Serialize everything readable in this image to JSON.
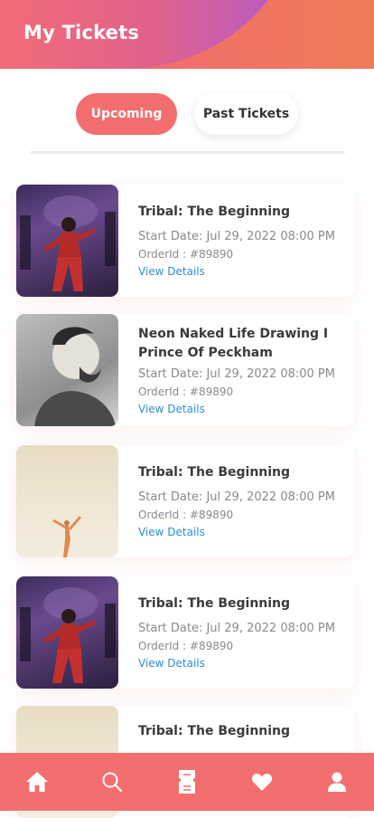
{
  "header": {
    "title": "My Tickets"
  },
  "tabs": [
    {
      "label": "Upcoming",
      "active": true
    },
    {
      "label": "Past Tickets",
      "active": false
    }
  ],
  "tickets": [
    {
      "title": "Tribal: The Beginning",
      "date": "Start Date: Jul 29, 2022 08:00 PM",
      "order": "OrderId : #89890",
      "link": "View Details"
    },
    {
      "title": "Neon Naked Life Drawing I Prince Of Peckham",
      "date": "Start Date: Jul 29, 2022 08:00 PM",
      "order": "OrderId : #89890",
      "link": "View Details"
    },
    {
      "title": "Tribal: The Beginning",
      "date": "Start Date: Jul 29, 2022 08:00 PM",
      "order": "OrderId : #89890",
      "link": "View Details"
    },
    {
      "title": "Tribal: The Beginning",
      "date": "Start Date: Jul 29, 2022 08:00 PM",
      "order": "OrderId : #89890",
      "link": "View Details"
    },
    {
      "title": "Tribal: The Beginning"
    }
  ],
  "nav": [
    {
      "icon": "home-icon"
    },
    {
      "icon": "search-icon"
    },
    {
      "icon": "ticket-icon"
    },
    {
      "icon": "heart-icon"
    },
    {
      "icon": "user-icon"
    }
  ],
  "colors": {
    "accent": "#f36e6e",
    "link": "#2b8fd0",
    "header_purple": "#b05bd0"
  }
}
